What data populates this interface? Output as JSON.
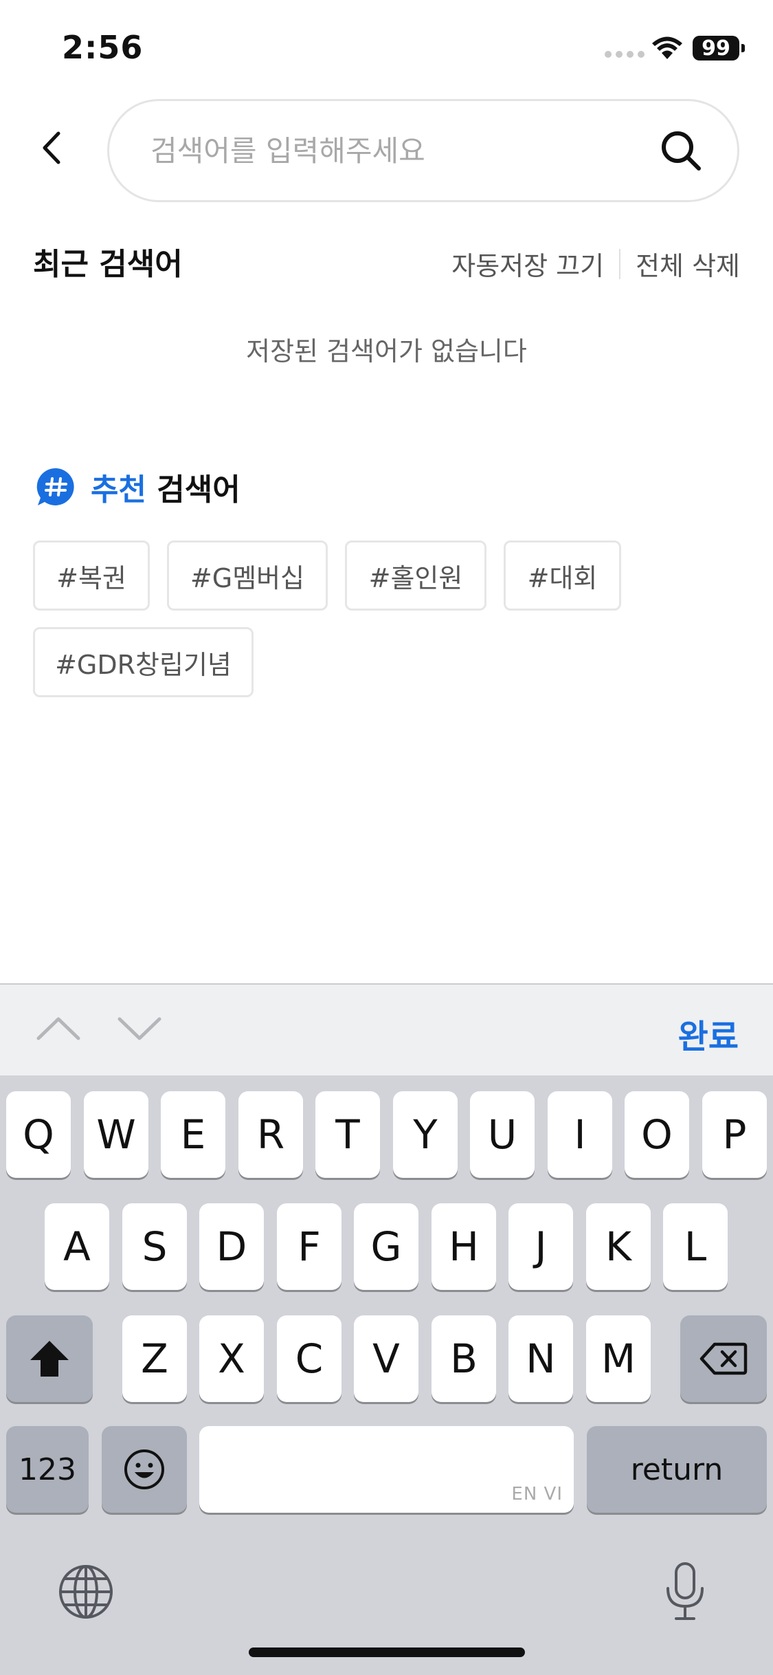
{
  "status_bar": {
    "time": "2:56",
    "battery": "99"
  },
  "search": {
    "placeholder": "검색어를 입력해주세요"
  },
  "recent": {
    "title": "최근 검색어",
    "auto_save_label": "자동저장 끄기",
    "delete_all_label": "전체 삭제",
    "empty_message": "저장된 검색어가 없습니다"
  },
  "recommended": {
    "title_accent": "추천",
    "title_rest": " 검색어",
    "tags": [
      "#복권",
      "#G멤버십",
      "#홀인원",
      "#대회",
      "#GDR창립기념"
    ]
  },
  "accessory": {
    "done_label": "완료"
  },
  "keyboard": {
    "row1": [
      "Q",
      "W",
      "E",
      "R",
      "T",
      "Y",
      "U",
      "I",
      "O",
      "P"
    ],
    "row2": [
      "A",
      "S",
      "D",
      "F",
      "G",
      "H",
      "J",
      "K",
      "L"
    ],
    "row3": [
      "Z",
      "X",
      "C",
      "V",
      "B",
      "N",
      "M"
    ],
    "numbers_label": "123",
    "return_label": "return",
    "space_hint": "EN VI"
  },
  "colors": {
    "accent": "#1a6fe0",
    "keyboard_bg": "#d1d3d9",
    "accessory_bg": "#eff0f2"
  },
  "icons": [
    "back-chevron-icon",
    "search-icon",
    "hashtag-chat-icon",
    "chevron-up-icon",
    "chevron-down-icon",
    "shift-icon",
    "delete-icon",
    "emoji-icon",
    "globe-icon",
    "microphone-icon",
    "wifi-icon"
  ]
}
